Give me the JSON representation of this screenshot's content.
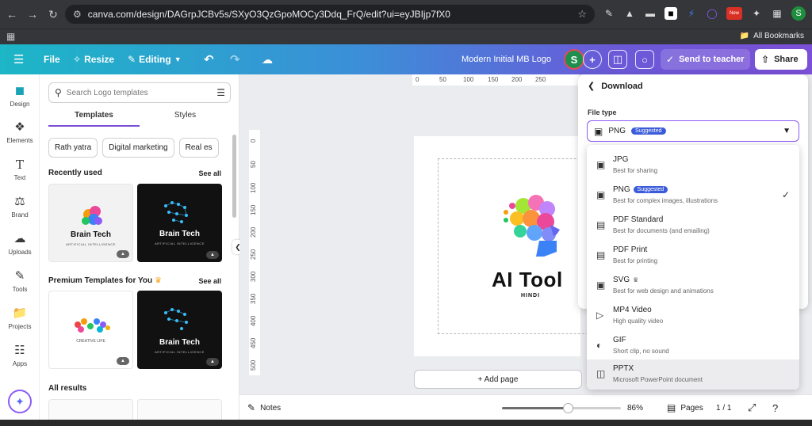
{
  "browser": {
    "url": "canva.com/design/DAGrpJCBv5s/SXyO3QzGpoMOCy3Ddq_FrQ/edit?ui=eyJBIjp7fX0",
    "all_bookmarks": "All Bookmarks",
    "profile_initial": "S",
    "new_badge": "New"
  },
  "toolbar": {
    "file": "File",
    "resize": "Resize",
    "editing": "Editing",
    "doc_title": "Modern Initial MB Logo",
    "avatar": "S",
    "send_to_teacher": "Send to teacher",
    "share": "Share"
  },
  "rail": [
    {
      "label": "Design",
      "icon": "design-icon"
    },
    {
      "label": "Elements",
      "icon": "elements-icon"
    },
    {
      "label": "Text",
      "icon": "text-icon"
    },
    {
      "label": "Brand",
      "icon": "brand-icon"
    },
    {
      "label": "Uploads",
      "icon": "uploads-icon"
    },
    {
      "label": "Tools",
      "icon": "tools-icon"
    },
    {
      "label": "Projects",
      "icon": "projects-icon"
    },
    {
      "label": "Apps",
      "icon": "apps-icon"
    }
  ],
  "panel": {
    "search_placeholder": "Search Logo templates",
    "tabs": [
      "Templates",
      "Styles"
    ],
    "chips": [
      "Rath yatra",
      "Digital marketing",
      "Real es"
    ],
    "recently_used": "Recently used",
    "see_all": "See all",
    "premium": "Premium Templates for You",
    "all_results": "All results",
    "thumbs": [
      {
        "title": "Brain Tech",
        "sub": "ARTIFICIAL INTELLIGENCE"
      },
      {
        "title": "Brain Tech",
        "sub": "ARTIFICIAL INTELLIGENCE"
      },
      {
        "title": "CREATIVE LIFE",
        "sub": ""
      },
      {
        "title": "Brain Tech",
        "sub": "ARTIFICIAL INTELLIGENCE"
      }
    ]
  },
  "canvas": {
    "ruler_top": [
      "0",
      "50",
      "100",
      "150",
      "200",
      "250"
    ],
    "ruler_left": [
      "0",
      "50",
      "100",
      "150",
      "200",
      "250",
      "300",
      "350",
      "400",
      "450",
      "500"
    ],
    "logo_title": "AI Tool",
    "logo_sub": "HINDI",
    "add_page": "+ Add page"
  },
  "bottom": {
    "notes": "Notes",
    "zoom": "86%",
    "zoom_level": 0.55,
    "pages": "Pages",
    "page_count": "1 / 1"
  },
  "download": {
    "title": "Download",
    "file_type_label": "File type",
    "selected": "PNG",
    "suggested": "Suggested",
    "options": [
      {
        "name": "JPG",
        "desc": "Best for sharing",
        "icon": "image-icon"
      },
      {
        "name": "PNG",
        "desc": "Best for complex images, illustrations",
        "icon": "image-icon",
        "suggested": "Suggested",
        "checked": true
      },
      {
        "name": "PDF Standard",
        "desc": "Best for documents (and emailing)",
        "icon": "document-icon"
      },
      {
        "name": "PDF Print",
        "desc": "Best for printing",
        "icon": "document-icon"
      },
      {
        "name": "SVG",
        "desc": "Best for web design and animations",
        "icon": "image-icon",
        "crown": true
      },
      {
        "name": "MP4 Video",
        "desc": "High quality video",
        "icon": "video-icon"
      },
      {
        "name": "GIF",
        "desc": "Short clip, no sound",
        "icon": "gif-icon"
      },
      {
        "name": "PPTX",
        "desc": "Microsoft PowerPoint document",
        "icon": "presentation-icon"
      }
    ]
  },
  "colors": {
    "accent": "#7b4fd6",
    "teal": "#1cb6c6",
    "badge": "#3b5bdb"
  }
}
